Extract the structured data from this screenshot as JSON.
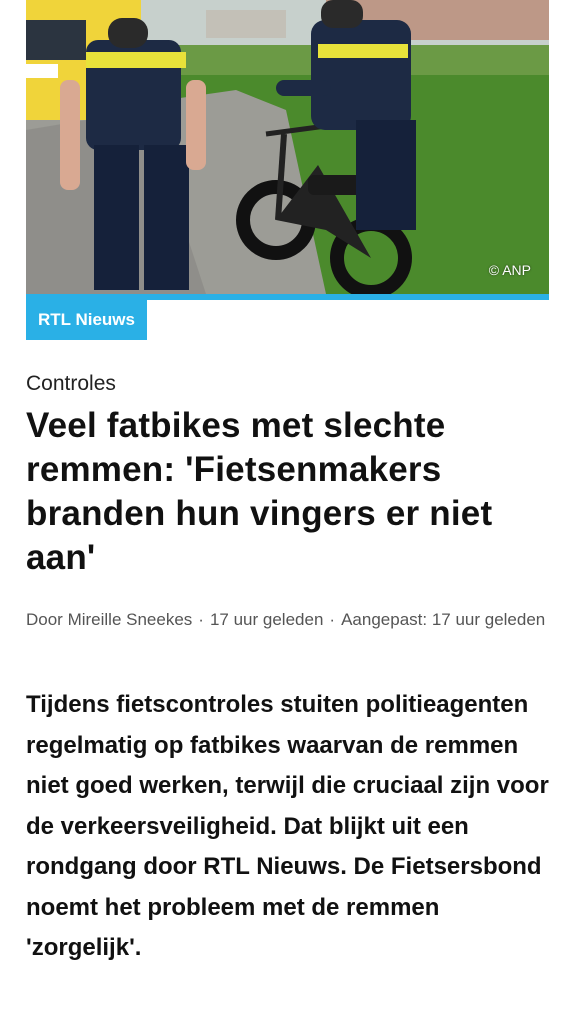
{
  "photo": {
    "credit": "© ANP"
  },
  "brand": {
    "label": "RTL Nieuws",
    "accent_color": "#2ab0e6"
  },
  "article": {
    "category": "Controles",
    "headline": "Veel fatbikes met slechte remmen: 'Fietsenmakers branden hun vingers er niet aan'",
    "byline": {
      "author": "Door Mireille Sneekes",
      "published": "17 uur geleden",
      "updated": "Aangepast: 17 uur geleden"
    },
    "lead": "Tijdens fietscontroles stuiten politieagenten regelmatig op fatbikes waarvan de remmen niet goed werken, terwijl die cruciaal zijn voor de verkeersveiligheid. Dat blijkt uit een rondgang door RTL Nieuws. De Fietsersbond noemt het probleem met de remmen 'zorgelijk'."
  }
}
